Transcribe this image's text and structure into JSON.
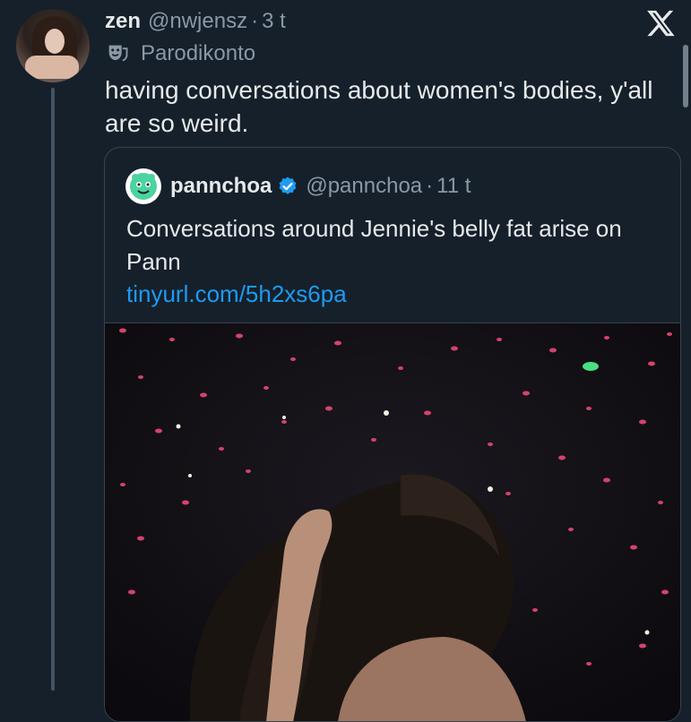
{
  "tweet": {
    "author_name": "zen",
    "handle": "@nwjensz",
    "separator": "·",
    "time": "3 t",
    "label_icon": "theater-mask-icon",
    "label": "Parodikonto",
    "text": "having conversations about women's bodies, y'all are so weird."
  },
  "window": {
    "close_icon": "x-logo-close-icon"
  },
  "quote": {
    "author_name": "pannchoa",
    "verified_icon": "verified-badge-icon",
    "handle": "@pannchoa",
    "separator": "·",
    "time": "11 t",
    "text": "Conversations around Jennie's belly fat arise on Pann",
    "link": "tinyurl.com/5h2xs6pa",
    "media_description": "concert photo with confetti"
  },
  "colors": {
    "background": "#15202b",
    "text": "#e7e9ea",
    "muted": "#8b98a5",
    "link": "#1d9bf0",
    "verified": "#1d9bf0",
    "border": "#38444d"
  }
}
